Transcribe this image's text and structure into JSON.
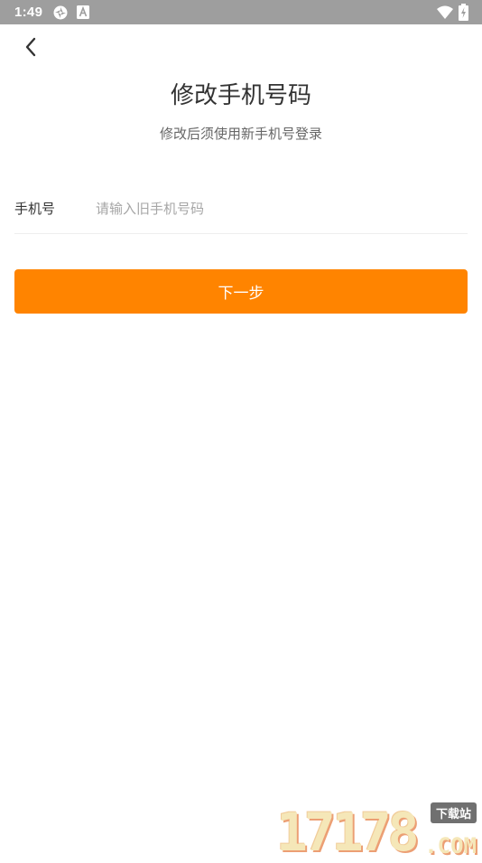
{
  "status_bar": {
    "time": "1:49",
    "left_icons": [
      "sync-icon",
      "keyboard-a-icon"
    ],
    "right_icons": [
      "wifi-icon",
      "battery-charging-icon"
    ],
    "background": "#9e9e9e"
  },
  "header": {
    "back_icon": "chevron-left-icon",
    "title": "修改手机号码",
    "subtitle": "修改后须使用新手机号登录"
  },
  "form": {
    "phone_label": "手机号",
    "phone_placeholder": "请输入旧手机号码",
    "phone_value": ""
  },
  "next_button": {
    "label": "下一步",
    "color": "#ff8400"
  },
  "watermark": {
    "digits": "17178",
    "tag": "下载站",
    "domain": ".COM"
  }
}
